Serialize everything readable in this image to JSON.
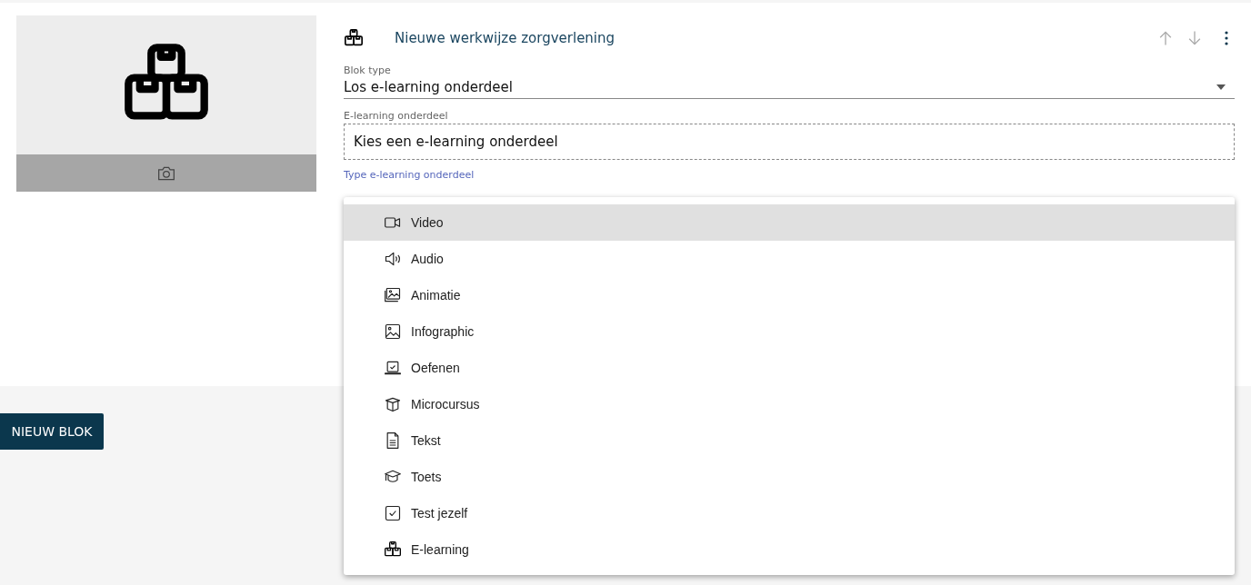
{
  "block": {
    "title": "Nieuwe werkwijze zorgverlening",
    "fields": [
      {
        "label": "Blok type",
        "value": "Los e-learning onderdeel"
      },
      {
        "label": "E-learning onderdeel",
        "placeholder": "Kies een e-learning onderdeel"
      },
      {
        "label": "Type e-learning onderdeel"
      }
    ]
  },
  "menu": [
    {
      "kind": "video",
      "label": "Video",
      "selected": true
    },
    {
      "kind": "audio",
      "label": "Audio",
      "selected": false
    },
    {
      "kind": "animation",
      "label": "Animatie",
      "selected": false
    },
    {
      "kind": "image",
      "label": "Infographic",
      "selected": false
    },
    {
      "kind": "exercise",
      "label": "Oefenen",
      "selected": false
    },
    {
      "kind": "course",
      "label": "Microcursus",
      "selected": false
    },
    {
      "kind": "text",
      "label": "Tekst",
      "selected": false
    },
    {
      "kind": "test",
      "label": "Toets",
      "selected": false
    },
    {
      "kind": "check",
      "label": "Test jezelf",
      "selected": false
    },
    {
      "kind": "boxes",
      "label": "E-learning",
      "selected": false
    }
  ],
  "new_block_button": "NIEUW BLOK"
}
